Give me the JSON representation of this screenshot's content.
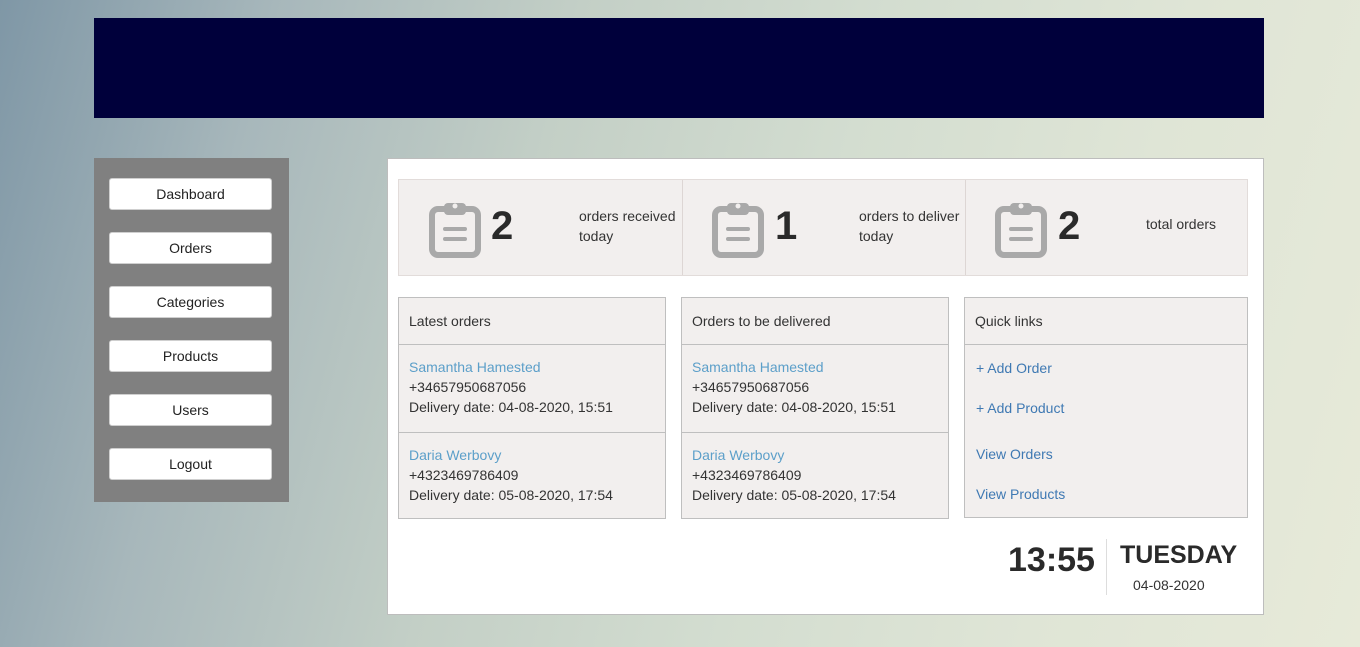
{
  "nav": {
    "items": [
      "Dashboard",
      "Orders",
      "Categories",
      "Products",
      "Users",
      "Logout"
    ]
  },
  "stats": [
    {
      "number": "2",
      "label_line1": "orders received",
      "label_line2": "today",
      "icon": "clipboard-icon"
    },
    {
      "number": "1",
      "label_line1": "orders to deliver",
      "label_line2": "today",
      "icon": "clipboard-icon"
    },
    {
      "number": "2",
      "label_line1": "total orders",
      "label_line2": "",
      "icon": "clipboard-icon"
    }
  ],
  "latest_orders": {
    "title": "Latest orders",
    "items": [
      {
        "name": "Samantha Hamested",
        "phone": "+34657950687056",
        "delivery": "Delivery date: 04-08-2020, 15:51"
      },
      {
        "name": "Daria Werbovy",
        "phone": "+4323469786409",
        "delivery": "Delivery date: 05-08-2020, 17:54"
      }
    ]
  },
  "to_deliver": {
    "title": "Orders to be delivered",
    "items": [
      {
        "name": "Samantha Hamested",
        "phone": "+34657950687056",
        "delivery": "Delivery date: 04-08-2020, 15:51"
      },
      {
        "name": "Daria Werbovy",
        "phone": "+4323469786409",
        "delivery": "Delivery date: 05-08-2020, 17:54"
      }
    ]
  },
  "quick_links": {
    "title": "Quick links",
    "items": [
      "+ Add Order",
      "+ Add Product",
      "View Orders",
      "View Products"
    ]
  },
  "clock": {
    "time": "13:55",
    "day": "TUESDAY",
    "date": "04-08-2020"
  },
  "colors": {
    "header_band": "#00003b",
    "sidebar": "#808080",
    "link_name": "#5c9fc9",
    "quick_link": "#3f79b3"
  }
}
